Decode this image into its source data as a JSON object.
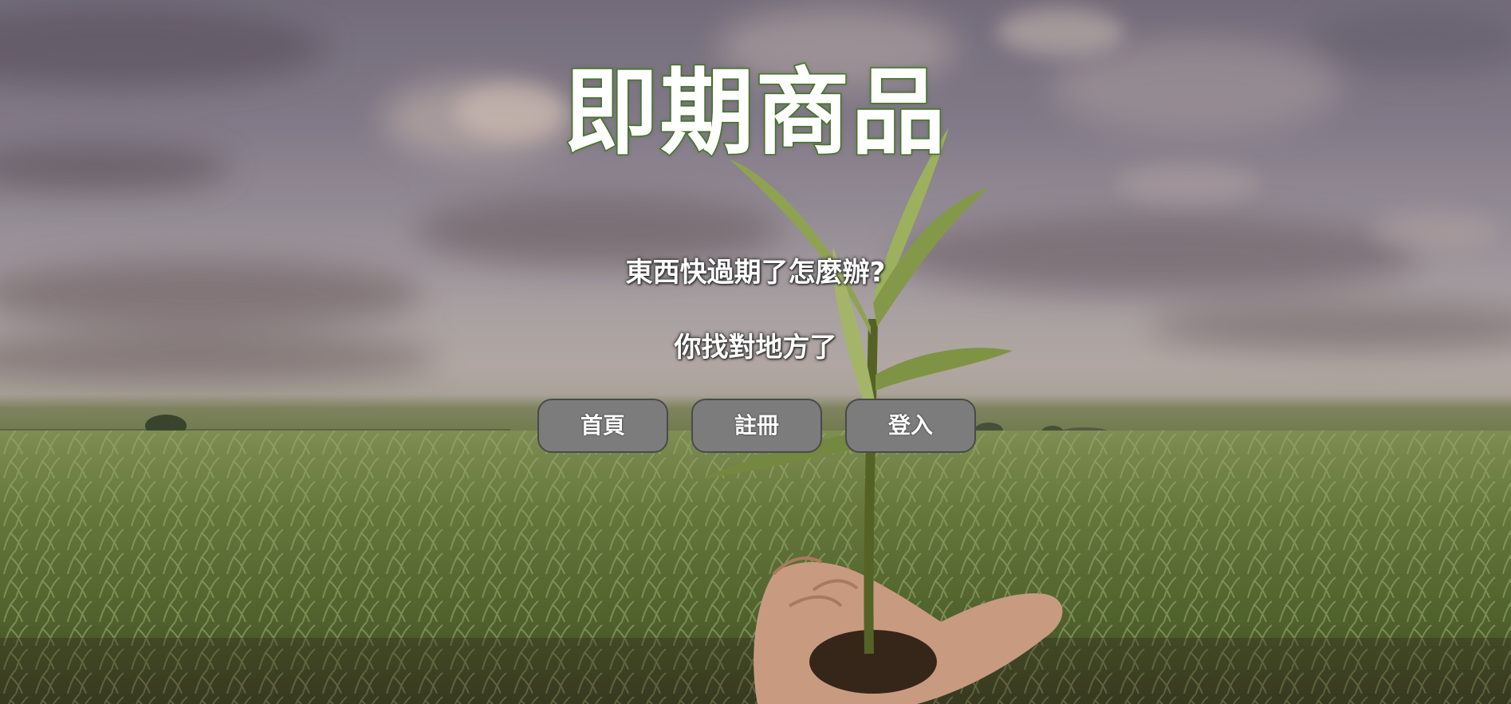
{
  "hero": {
    "title": "即期商品",
    "subtitle_1": "東西快過期了怎麼辦?",
    "subtitle_2": "你找對地方了"
  },
  "nav": {
    "home_label": "首頁",
    "register_label": "註冊",
    "login_label": "登入"
  },
  "colors": {
    "title_outline": "#4a7a2c",
    "button_bg": "#7c7c7c",
    "button_border": "#4a4a4a",
    "text": "#ffffff"
  }
}
